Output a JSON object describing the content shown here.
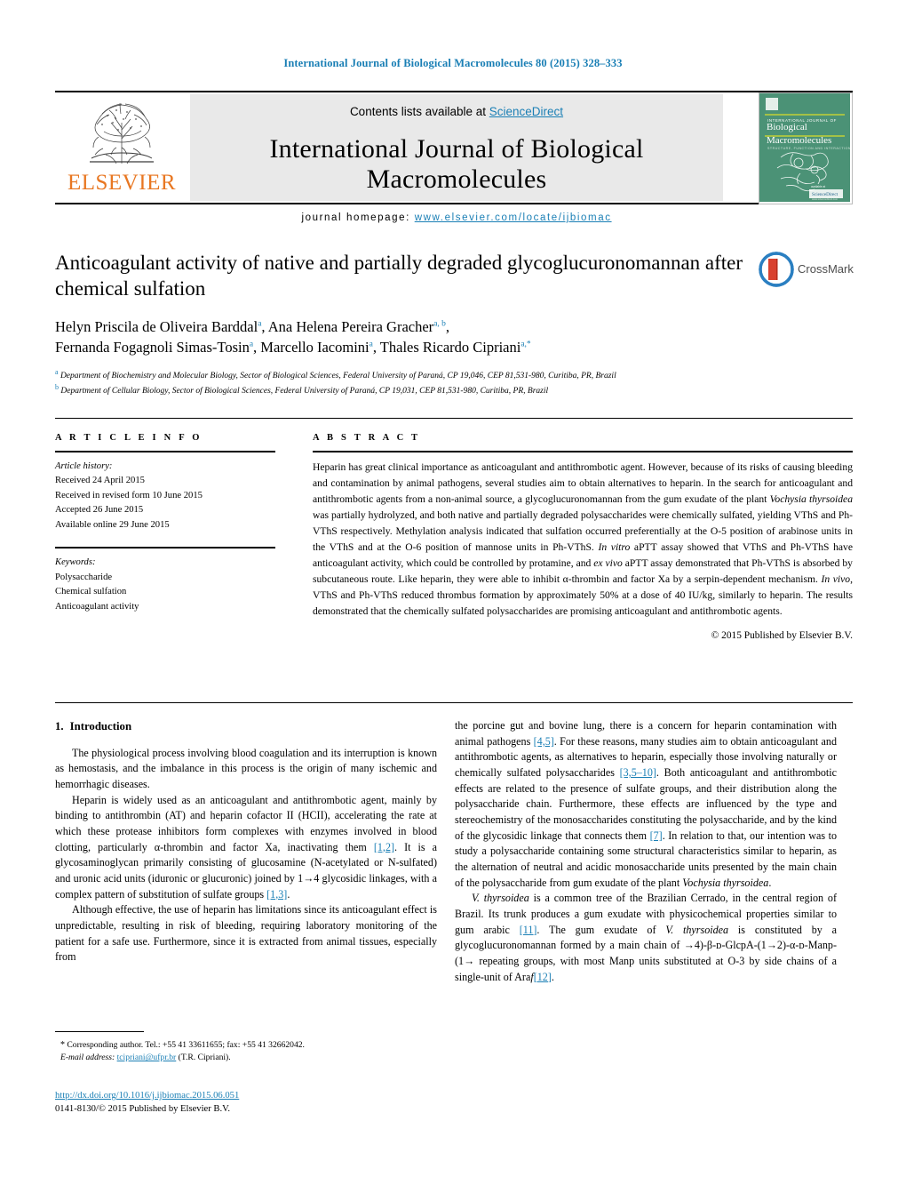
{
  "running_head": "International Journal of Biological Macromolecules 80 (2015) 328–333",
  "masthead": {
    "contents_prefix": "Contents lists available at ",
    "sciencedirect": "ScienceDirect",
    "journal_title": "International Journal of Biological Macromolecules",
    "homepage_label": "journal homepage: ",
    "homepage_url": "www.elsevier.com/locate/ijbiomac",
    "publisher": "ELSEVIER",
    "cover_line1": "INTERNATIONAL JOURNAL OF",
    "cover_line2": "Biological",
    "cover_line3": "Macromolecules",
    "cover_line4": "STRUCTURE, FUNCTION AND INTERACTIONS",
    "cover_footer": "ScienceDirect",
    "cover_footer_sub": "www.sciencedirect.com"
  },
  "article": {
    "title": "Anticoagulant activity of native and partially degraded glycoglucuronomannan after chemical sulfation",
    "authors_line1_a": "Helyn Priscila de Oliveira Barddal",
    "authors_line1_a_sup": "a",
    "authors_line1_b": ", Ana Helena Pereira Gracher",
    "authors_line1_b_sup": "a, b",
    "authors_line2_a": "Fernanda Fogagnoli Simas-Tosin",
    "authors_line2_a_sup": "a",
    "authors_line2_b": ", Marcello Iacomini",
    "authors_line2_b_sup": "a",
    "authors_line2_c": ", Thales Ricardo Cipriani",
    "authors_line2_c_sup": "a,*",
    "affiliation_a_sup": "a",
    "affiliation_a": "Department of Biochemistry and Molecular Biology, Sector of Biological Sciences, Federal University of Paraná, CP 19,046, CEP 81,531-980, Curitiba, PR, Brazil",
    "affiliation_b_sup": "b",
    "affiliation_b": "Department of Cellular Biology, Sector of Biological Sciences, Federal University of Paraná, CP 19,031, CEP 81,531-980, Curitiba, PR, Brazil",
    "crossmark_label": "CrossMark"
  },
  "article_info": {
    "heading": "A R T I C L E    I N F O",
    "history_label": "Article history:",
    "history": [
      "Received 24 April 2015",
      "Received in revised form 10 June 2015",
      "Accepted 26 June 2015",
      "Available online 29 June 2015"
    ],
    "keywords_label": "Keywords:",
    "keywords": [
      "Polysaccharide",
      "Chemical sulfation",
      "Anticoagulant activity"
    ]
  },
  "abstract": {
    "heading": "A B S T R A C T",
    "part1": "Heparin has great clinical importance as anticoagulant and antithrombotic agent. However, because of its risks of causing bleeding and contamination by animal pathogens, several studies aim to obtain alternatives to heparin. In the search for anticoagulant and antithrombotic agents from a non-animal source, a glycoglucuronomannan from the gum exudate of the plant ",
    "italic1": "Vochysia thyrsoidea",
    "part2": " was partially hydrolyzed, and both native and partially degraded polysaccharides were chemically sulfated, yielding VThS and Ph-VThS respectively. Methylation analysis indicated that sulfation occurred preferentially at the O-5 position of arabinose units in the VThS and at the O-6 position of mannose units in Ph-VThS. ",
    "italic2": "In vitro",
    "part3": " aPTT assay showed that VThS and Ph-VThS have anticoagulant activity, which could be controlled by protamine, and ",
    "italic3": "ex vivo",
    "part4": " aPTT assay demonstrated that Ph-VThS is absorbed by subcutaneous route. Like heparin, they were able to inhibit α-thrombin and factor Xa by a serpin-dependent mechanism. ",
    "italic4": "In vivo",
    "part5": ", VThS and Ph-VThS reduced thrombus formation by approximately 50% at a dose of 40 IU/kg, similarly to heparin. The results demonstrated that the chemically sulfated polysaccharides are promising anticoagulant and antithrombotic agents.",
    "copyright": "© 2015 Published by Elsevier B.V."
  },
  "introduction": {
    "number": "1.",
    "heading": "Introduction",
    "left": {
      "p1": "The physiological process involving blood coagulation and its interruption is known as hemostasis, and the imbalance in this process is the origin of many ischemic and hemorrhagic diseases.",
      "p2_a": "Heparin is widely used as an anticoagulant and antithrombotic agent, mainly by binding to antithrombin (AT) and heparin cofactor II (HCII), accelerating the rate at which these protease inhibitors form complexes with enzymes involved in blood clotting, particularly α-thrombin and factor Xa, inactivating them ",
      "p2_ref1": "[1,2]",
      "p2_b": ". It is a glycosaminoglycan primarily consisting of glucosamine (N-acetylated or N-sulfated) and uronic acid units (iduronic or glucuronic) joined by 1→4 glycosidic linkages, with a complex pattern of substitution of sulfate groups ",
      "p2_ref2": "[1,3]",
      "p2_c": ".",
      "p3": "Although effective, the use of heparin has limitations since its anticoagulant effect is unpredictable, resulting in risk of bleeding, requiring laboratory monitoring of the patient for a safe use. Furthermore, since it is extracted from animal tissues, especially from"
    },
    "right": {
      "p1_a": "the porcine gut and bovine lung, there is a concern for heparin contamination with animal pathogens ",
      "p1_ref1": "[4,5]",
      "p1_b": ". For these reasons, many studies aim to obtain anticoagulant and antithrombotic agents, as alternatives to heparin, especially those involving naturally or chemically sulfated polysaccharides ",
      "p1_ref2": "[3,5–10]",
      "p1_c": ". Both anticoagulant and antithrombotic effects are related to the presence of sulfate groups, and their distribution along the polysaccharide chain. Furthermore, these effects are influenced by the type and stereochemistry of the monosaccharides constituting the polysaccharide, and by the kind of the glycosidic linkage that connects them ",
      "p1_ref3": "[7]",
      "p1_d": ". In relation to that, our intention was to study a polysaccharide containing some structural characteristics similar to heparin, as the alternation of neutral and acidic monosaccharide units presented by the main chain of the polysaccharide from gum exudate of the plant ",
      "p1_italic": "Vochysia thyrsoidea",
      "p1_e": ".",
      "p2_italic1": "V. thyrsoidea",
      "p2_a": " is a common tree of the Brazilian Cerrado, in the central region of Brazil. Its trunk produces a gum exudate with physicochemical properties similar to gum arabic ",
      "p2_ref1": "[11]",
      "p2_b": ". The gum exudate of ",
      "p2_italic2": "V. thyrsoidea",
      "p2_c": " is constituted by a glycoglucuronomannan formed by a main chain of →4)-β-ᴅ-GlcpA-(1→2)-α-ᴅ-Manp-(1→ repeating groups, with most Manp units substituted at O-3 by side chains of a single-unit of Ara",
      "p2_italic3": "f",
      "p2_ref2": "[12]",
      "p2_d": "."
    }
  },
  "footnote": {
    "star": "*",
    "corresponding": " Corresponding author. Tel.: +55 41 33611655; fax: +55 41 32662042.",
    "email_label": "E-mail address:",
    "email": "tcipriani@ufpr.br",
    "email_suffix": " (T.R. Cipriani)."
  },
  "footer": {
    "doi": "http://dx.doi.org/10.1016/j.ijbiomac.2015.06.051",
    "issn": "0141-8130/© 2015 Published by Elsevier B.V."
  },
  "colors": {
    "link": "#1a7fb5",
    "elsevier_orange": "#E87722",
    "masthead_gray": "#e9e9e9",
    "cover_green": "#3f8f6e"
  }
}
